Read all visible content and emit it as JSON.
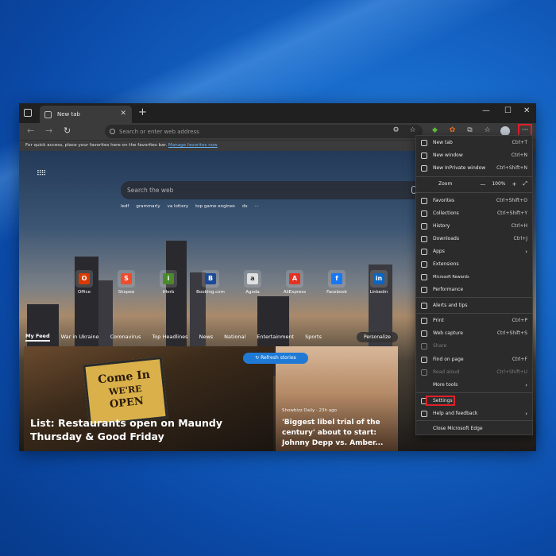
{
  "browser": {
    "tab": {
      "title": "New tab"
    },
    "address_placeholder": "Search or enter web address",
    "favorites_bar": {
      "text": "For quick access, place your favorites here on the favorites bar.",
      "link": "Manage favorites now"
    },
    "more_button": "···",
    "window_controls": {
      "minimize": "—",
      "maximize": "☐",
      "close": "✕"
    }
  },
  "newtab": {
    "search_placeholder": "Search the web",
    "chips": [
      "ledf",
      "grammarly",
      "va lottery",
      "top game engines",
      "dx",
      "···"
    ],
    "tiles": [
      {
        "label": "Office",
        "glyph": "O",
        "color": "#d83b01"
      },
      {
        "label": "Shopee",
        "glyph": "S",
        "color": "#ee4d2d"
      },
      {
        "label": "iHerb",
        "glyph": "i",
        "color": "#4a8a2a"
      },
      {
        "label": "Booking.com",
        "glyph": "B",
        "color": "#1b4a9a"
      },
      {
        "label": "Agoda",
        "glyph": "a",
        "color": "#e0e0e0"
      },
      {
        "label": "AliExpress",
        "glyph": "A",
        "color": "#e43225"
      },
      {
        "label": "Facebook",
        "glyph": "f",
        "color": "#1877f2"
      },
      {
        "label": "Linkedin",
        "glyph": "in",
        "color": "#0a66c2"
      }
    ],
    "feed_tabs": [
      "My Feed",
      "War in Ukraine",
      "Coronavirus",
      "Top Headlines",
      "News",
      "National",
      "Entertainment",
      "Sports"
    ],
    "personalize": "Personalize",
    "refresh": "Refresh stories",
    "card1": {
      "sign_l1": "Come In",
      "sign_l2": "WE'RE",
      "sign_l3": "OPEN",
      "title": "List: Restaurants open on Maundy Thursday & Good Friday"
    },
    "card2": {
      "source": "Showbizz Daily · 23h ago",
      "title": "'Biggest libel trial of the century' about to start: Johnny Depp vs. Amber..."
    }
  },
  "menu": {
    "items": [
      {
        "label": "New tab",
        "shortcut": "Ctrl+T"
      },
      {
        "label": "New window",
        "shortcut": "Ctrl+N"
      },
      {
        "label": "New InPrivate window",
        "shortcut": "Ctrl+Shift+N"
      },
      {
        "label": "Zoom",
        "zoom": "100%"
      },
      {
        "label": "Favorites",
        "shortcut": "Ctrl+Shift+O"
      },
      {
        "label": "Collections",
        "shortcut": "Ctrl+Shift+Y"
      },
      {
        "label": "History",
        "shortcut": "Ctrl+H"
      },
      {
        "label": "Downloads",
        "shortcut": "Ctrl+J"
      },
      {
        "label": "Apps",
        "arrow": true
      },
      {
        "label": "Extensions"
      },
      {
        "label": "Microsoft Rewards"
      },
      {
        "label": "Performance"
      },
      {
        "label": "Alerts and tips"
      },
      {
        "label": "Print",
        "shortcut": "Ctrl+P"
      },
      {
        "label": "Web capture",
        "shortcut": "Ctrl+Shift+S"
      },
      {
        "label": "Share",
        "disabled": true
      },
      {
        "label": "Find on page",
        "shortcut": "Ctrl+F"
      },
      {
        "label": "Read aloud",
        "shortcut": "Ctrl+Shift+U",
        "disabled": true
      },
      {
        "label": "More tools",
        "arrow": true
      },
      {
        "label": "Settings"
      },
      {
        "label": "Help and feedback",
        "arrow": true
      },
      {
        "label": "Close Microsoft Edge"
      }
    ],
    "zoom_minus": "—",
    "zoom_plus": "+",
    "zoom_full": "⤢"
  }
}
